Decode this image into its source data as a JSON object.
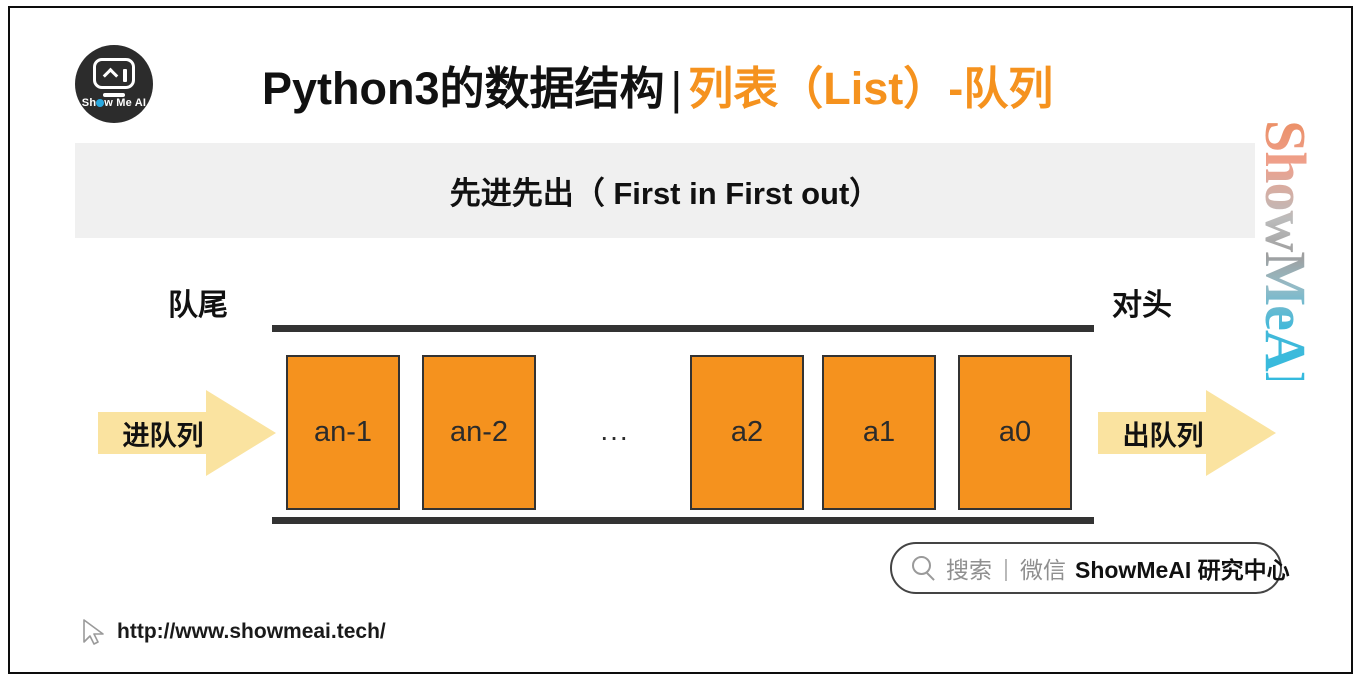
{
  "brand": {
    "logo_alt": "Show Me AI",
    "logo_text_pre": "Sh",
    "logo_text_post": "w Me AI",
    "watermark": "ShowMeAI",
    "accent_color": "#F5921E",
    "arrow_color": "#FAE3A0",
    "rail_color": "#333333",
    "band_color": "#f0f0f0"
  },
  "header": {
    "title_main": "Python3的数据结构",
    "title_separator": "|",
    "title_accent": "列表（List）-队列"
  },
  "subtitle": {
    "text": "先进先出（ First in First out）"
  },
  "diagram": {
    "label_tail": "队尾",
    "label_head": "对头",
    "arrow_in_label": "进队列",
    "arrow_out_label": "出队列",
    "ellipsis": "...",
    "cells": [
      {
        "label": "an-1"
      },
      {
        "label": "an-2"
      },
      {
        "label": "a2"
      },
      {
        "label": "a1"
      },
      {
        "label": "a0"
      }
    ]
  },
  "search_badge": {
    "icon": "search-icon",
    "label_search": "搜索",
    "divider": "|",
    "label_channel": "微信",
    "label_account": "ShowMeAI 研究中心"
  },
  "footer": {
    "icon": "cursor-icon",
    "url": "http://www.showmeai.tech/"
  }
}
